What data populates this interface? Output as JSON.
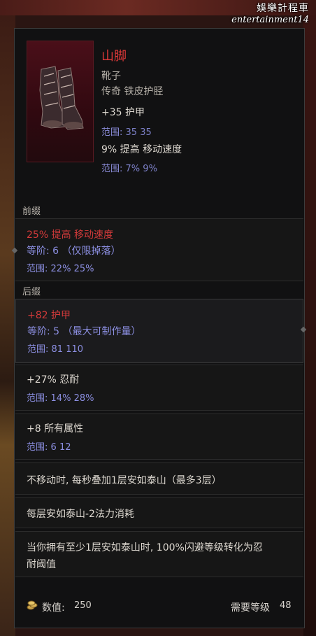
{
  "watermark": {
    "line1": "娛樂計程車",
    "line2": "entertainment14"
  },
  "item": {
    "name": "山脚",
    "type": "靴子",
    "rarity": "传奇 铁皮护胫",
    "icon": "greaves-boots-icon",
    "implicits": [
      {
        "stat": "+35 护甲",
        "range_label": "范围:",
        "range_min": "35",
        "range_max": "35"
      },
      {
        "stat": "9% 提高 移动速度",
        "range_label": "范围:",
        "range_min": "7%",
        "range_max": "9%"
      }
    ]
  },
  "prefix": {
    "label": "前缀",
    "stat": "25% 提高 移动速度",
    "tier": "等阶: 6 （仅限掉落）",
    "range_label": "范围:",
    "range_min": "22%",
    "range_max": "25%"
  },
  "suffix": {
    "label": "后缀",
    "stat": "+82 护甲",
    "tier": "等阶: 5 （最大可制作量）",
    "range_label": "范围:",
    "range_min": "81",
    "range_max": "110"
  },
  "extra_affixes": [
    {
      "stat": "+27% 忍耐",
      "range_label": "范围:",
      "range_min": "14%",
      "range_max": "28%"
    },
    {
      "stat": "+8 所有属性",
      "range_label": "范围:",
      "range_min": "6",
      "range_max": "12"
    }
  ],
  "unique_mods": [
    "不移动时, 每秒叠加1层安如泰山（最多3层）",
    "每层安如泰山-2法力消耗",
    "当你拥有至少1层安如泰山时, 100%闪避等级转化为忍",
    "耐阈值"
  ],
  "footer": {
    "value_label": "数值:",
    "value": "250",
    "level_label": "需要等级",
    "level": "48"
  },
  "colors": {
    "name": "#e23a3a",
    "affix_red": "#d33a3a",
    "range_blue": "#8b8ee0",
    "panel_bg": "#111112"
  }
}
